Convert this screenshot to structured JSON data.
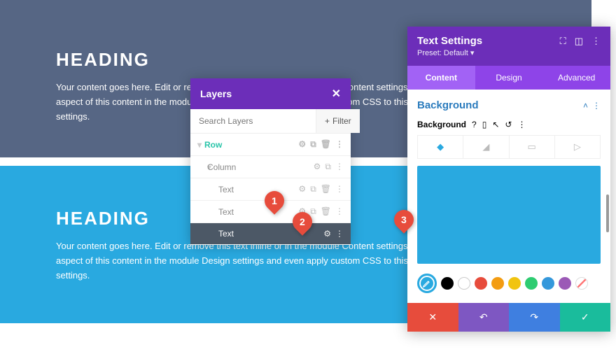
{
  "banners": {
    "dark": {
      "heading": "HEADING",
      "body": "Your content goes here. Edit or remove this text inline or in the module Content settings. You can also style every aspect of this content in the module Design settings and even apply custom CSS to this text in the module Advanced settings."
    },
    "blue": {
      "heading": "HEADING",
      "body": "Your content goes here. Edit or remove this text inline or in the module Content settings. You can also style every aspect of this content in the module Design settings and even apply custom CSS to this text in the module Advanced settings."
    }
  },
  "layers": {
    "title": "Layers",
    "search_placeholder": "Search Layers",
    "filter_label": "Filter",
    "rows": [
      {
        "label": "Row",
        "type": "row"
      },
      {
        "label": "Column",
        "type": "column"
      },
      {
        "label": "Text",
        "type": "text"
      },
      {
        "label": "Text",
        "type": "text"
      },
      {
        "label": "Text",
        "type": "text",
        "selected": true
      }
    ]
  },
  "settings": {
    "title": "Text Settings",
    "preset": "Preset: Default ▾",
    "tabs": {
      "content": "Content",
      "design": "Design",
      "advanced": "Advanced"
    },
    "section": "Background",
    "bg_label": "Background",
    "swatches": [
      "#000000",
      "#ffffff",
      "#e74c3c",
      "#f39c12",
      "#f1c40f",
      "#2ecc71",
      "#3498db",
      "#9b59b6"
    ]
  },
  "markers": {
    "m1": "1",
    "m2": "2",
    "m3": "3"
  }
}
